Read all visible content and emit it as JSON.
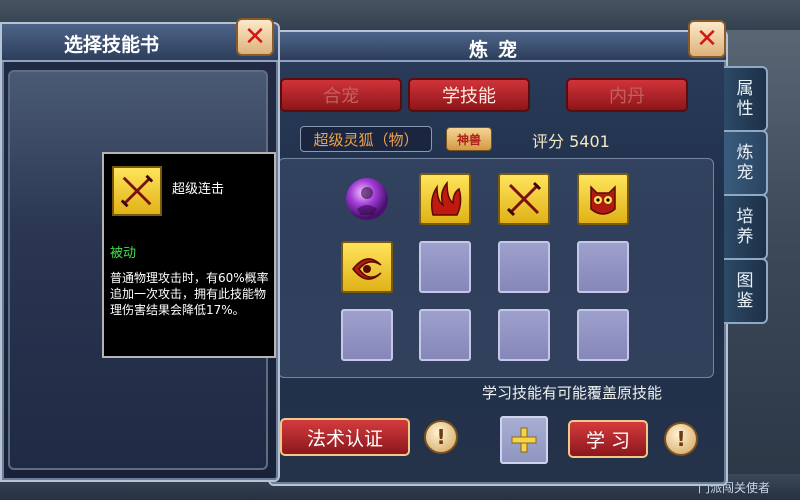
{
  "background": {
    "bottom_text": "门派闯关使者"
  },
  "pet_window": {
    "title": "炼宠",
    "tabs": [
      {
        "label": "合宠"
      },
      {
        "label": "学技能"
      },
      {
        "label": "内丹"
      }
    ],
    "pet_name": "超级灵狐（物）",
    "pet_badge": "神兽",
    "score": "评分 5401",
    "skills": [
      {
        "icon": "purple-orb-icon"
      },
      {
        "icon": "flame-claw-icon"
      },
      {
        "icon": "crossed-swords-icon"
      },
      {
        "icon": "owl-icon"
      },
      {
        "icon": "eye-swirl-icon"
      }
    ],
    "learn_hint": "学习技能有可能覆盖原技能",
    "certify_button": "法术认证",
    "learn_button": "学 习",
    "info_glyph": "!",
    "add_glyph": "+"
  },
  "side_tabs": [
    {
      "label_top": "属",
      "label_bottom": "性"
    },
    {
      "label_top": "炼",
      "label_bottom": "宠"
    },
    {
      "label_top": "培",
      "label_bottom": "养"
    },
    {
      "label_top": "图",
      "label_bottom": "鉴"
    }
  ],
  "skillbook_window": {
    "title": "选择技能书"
  },
  "tooltip": {
    "skill_name": "超级连击",
    "skill_type": "被动",
    "description": "普通物理攻击时，有60%概率追加一次攻击，拥有此技能物理伤害结果会降低17%。"
  },
  "colors": {
    "accent_red": "#c62a2f",
    "passive_green": "#3fe04b",
    "score_text": "#f4e7c4",
    "pet_name": "#f0a24a"
  }
}
